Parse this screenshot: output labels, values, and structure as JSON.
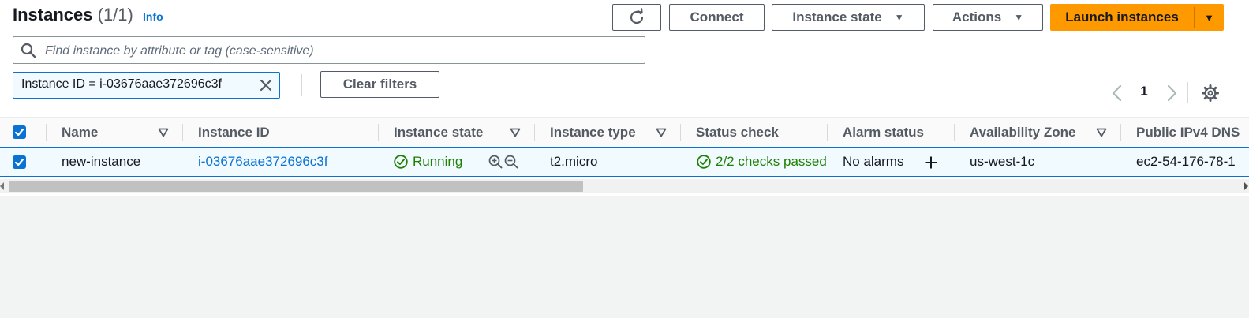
{
  "header": {
    "title": "Instances",
    "count": "(1/1)",
    "info_link": "Info"
  },
  "toolbar": {
    "refresh_icon": "refresh-icon",
    "connect_label": "Connect",
    "instance_state_label": "Instance state",
    "actions_label": "Actions",
    "launch_label": "Launch instances"
  },
  "search": {
    "placeholder": "Find instance by attribute or tag (case-sensitive)"
  },
  "filters": {
    "token_text": "Instance ID = i-03676aae372696c3f",
    "clear_label": "Clear filters"
  },
  "pagination": {
    "current_page": "1"
  },
  "table": {
    "columns": [
      {
        "label": "Name",
        "sortable": true
      },
      {
        "label": "Instance ID",
        "sortable": false
      },
      {
        "label": "Instance state",
        "sortable": true
      },
      {
        "label": "Instance type",
        "sortable": true
      },
      {
        "label": "Status check",
        "sortable": false
      },
      {
        "label": "Alarm status",
        "sortable": false
      },
      {
        "label": "Availability Zone",
        "sortable": true
      },
      {
        "label": "Public IPv4 DNS",
        "sortable": false
      }
    ],
    "rows": [
      {
        "selected": true,
        "name": "new-instance",
        "instance_id": "i-03676aae372696c3f",
        "instance_state": "Running",
        "instance_type": "t2.micro",
        "status_check": "2/2 checks passed",
        "alarm_status": "No alarms",
        "availability_zone": "us-west-1c",
        "public_dns": "ec2-54-176-78-1"
      }
    ]
  },
  "colors": {
    "accent": "#0972d3",
    "launch": "#ff9900",
    "success": "#1d8102"
  }
}
